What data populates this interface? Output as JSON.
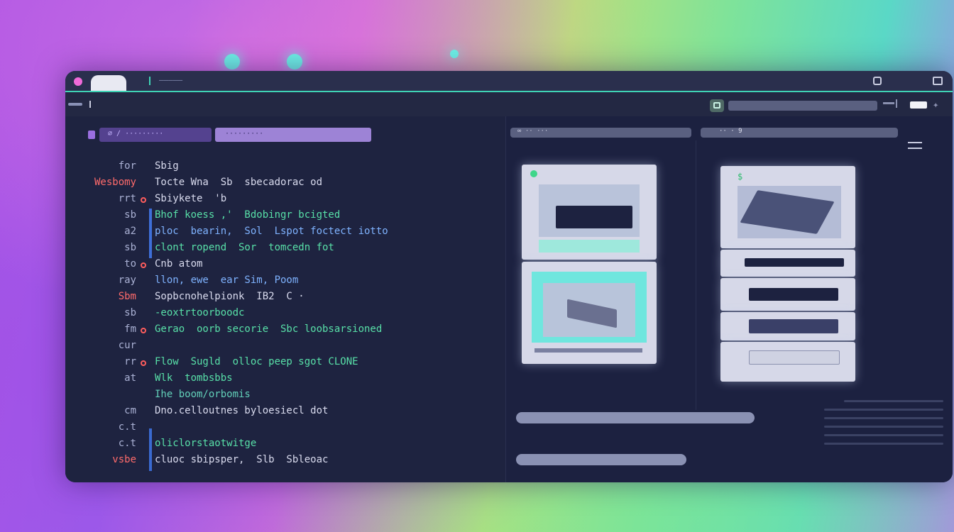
{
  "titlebar": {
    "tab_text": "",
    "title": "—————"
  },
  "toolbar": {
    "address": "",
    "arrow": "✦"
  },
  "editor": {
    "tabs": [
      {
        "label": "∅ ∕ ·········"
      },
      {
        "label": "·········"
      }
    ],
    "lines": [
      {
        "num": "for",
        "num_color": "white",
        "text": "Sbig",
        "color": "white",
        "marker": false
      },
      {
        "num": "Wesbomy",
        "num_color": "red",
        "text": "Tocte Wna  Sb  sbecadorac od",
        "color": "white",
        "marker": false
      },
      {
        "num": "rrt",
        "num_color": "white",
        "text": "Sbiykete  'b",
        "color": "white",
        "marker": true
      },
      {
        "num": "sb",
        "num_color": "white",
        "text": "Bhof koess ,'  Bdobingr bcigted",
        "color": "green",
        "marker": false
      },
      {
        "num": "a2",
        "num_color": "white",
        "text": "ploc  bearin,  Sol  Lspot foctect iotto",
        "color": "blue",
        "marker": false
      },
      {
        "num": "sb",
        "num_color": "white",
        "text": "clont ropend  Sor  tomcedn fot",
        "color": "green",
        "marker": false
      },
      {
        "num": "to",
        "num_color": "white",
        "text": "Cnb atom",
        "color": "white",
        "marker": true
      },
      {
        "num": "ray",
        "num_color": "white",
        "text": "llon, ewe  ear Sim, Poom",
        "color": "blue",
        "marker": false
      },
      {
        "num": "Sbm",
        "num_color": "red",
        "text": "Sopbcnohelpionk  IB2  C ·",
        "color": "white",
        "marker": false
      },
      {
        "num": "sb",
        "num_color": "white",
        "text": "-eoxtrtoorboodc",
        "color": "green",
        "marker": false
      },
      {
        "num": "fm",
        "num_color": "white",
        "text": "Gerao  oorb secorie  Sbc loobsarsioned",
        "color": "green",
        "marker": true
      },
      {
        "num": "cur",
        "num_color": "white",
        "text": "",
        "color": "white",
        "marker": false
      },
      {
        "num": "rr",
        "num_color": "white",
        "text": "Flow  Sugld  olloc peep sgot CLONE",
        "color": "green",
        "marker": true
      },
      {
        "num": "at",
        "num_color": "white",
        "text": "Wlk  tombsbbs",
        "color": "green",
        "marker": false
      },
      {
        "num": "",
        "num_color": "white",
        "text": "Ihe boom/orbomis",
        "color": "teal",
        "marker": false
      },
      {
        "num": "cm",
        "num_color": "white",
        "text": "Dno.celloutnes byloesiecl dot",
        "color": "white",
        "marker": false
      },
      {
        "num": "c.t",
        "num_color": "white",
        "text": "",
        "color": "white",
        "marker": false
      },
      {
        "num": "c.t",
        "num_color": "white",
        "text": "oliclorstaotwitge",
        "color": "green",
        "marker": false
      },
      {
        "num": "vsbe",
        "num_color": "red",
        "text": "cluoc sbipsper,  Slb  Sbleoac",
        "color": "white",
        "marker": false
      }
    ]
  },
  "preview": {
    "header_left": "∞ ··  ···",
    "header_right": "··  ·  9",
    "colors": {
      "accent": "#3fd4b6",
      "card": "#d6d8e8",
      "slab": "#1d2240"
    }
  }
}
